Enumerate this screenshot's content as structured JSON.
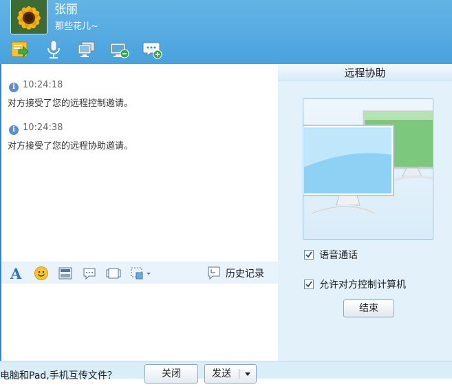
{
  "header": {
    "contact_name": "张丽",
    "signature": "那些花儿~"
  },
  "toolbar": {
    "icons": [
      "file-transfer-icon",
      "microphone-icon",
      "remote-desktop-icon",
      "remote-assist-icon",
      "add-chat-icon"
    ]
  },
  "chat": {
    "messages": [
      {
        "time": "10:24:18",
        "text": "对方接受了您的远程控制邀请。"
      },
      {
        "time": "10:24:38",
        "text": "对方接受了您的远程协助邀请。"
      }
    ]
  },
  "format_bar": {
    "history_label": "历史记录"
  },
  "right_panel": {
    "title": "远程协助",
    "voice_call_label": "语音通话",
    "voice_call_checked": true,
    "allow_control_label": "允许对方控制计算机",
    "allow_control_checked": true,
    "end_button_label": "结束"
  },
  "bottom_bar": {
    "transfer_tip": "电脑和Pad,手机互传文件？",
    "close_label": "关闭",
    "send_label": "发送"
  },
  "colors": {
    "header_blue": "#4ea6df",
    "panel_bg": "#e3f1fb",
    "accent_border": "#2f86c9"
  }
}
